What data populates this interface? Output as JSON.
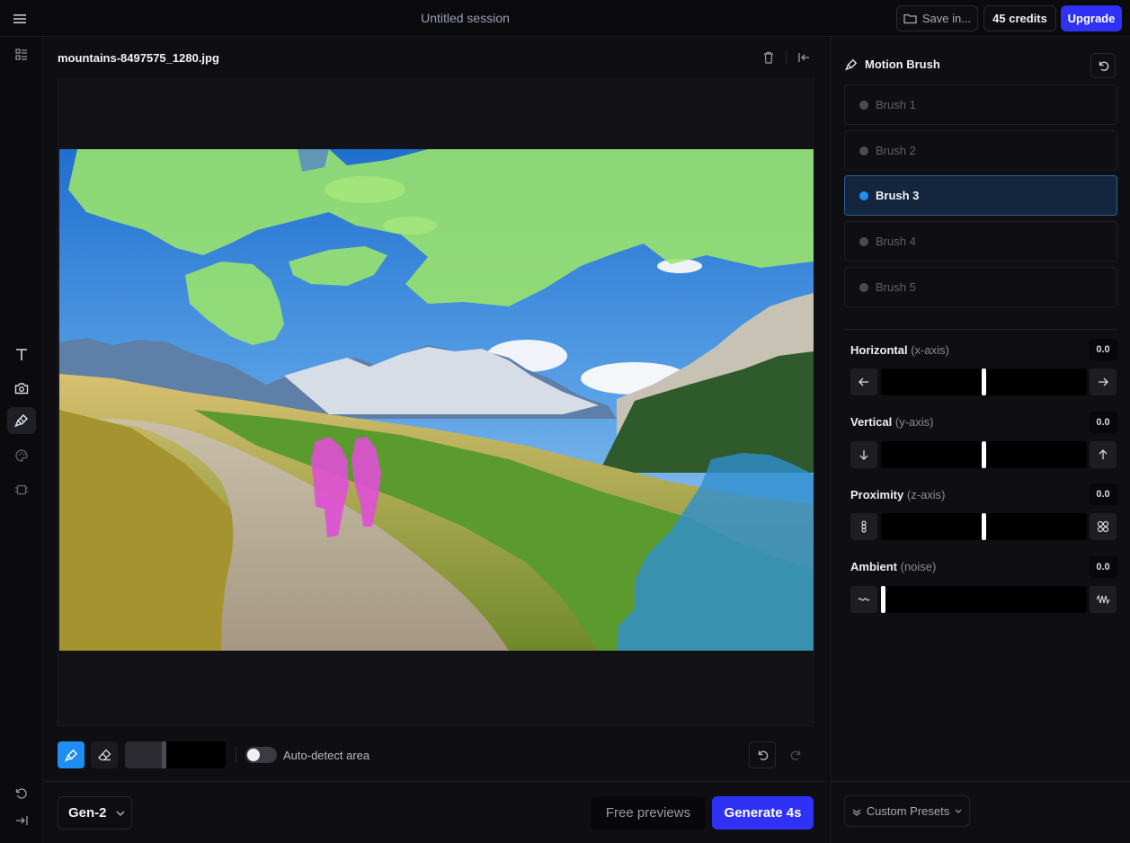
{
  "header": {
    "session_title": "Untitled session",
    "save_label": "Save in...",
    "credits_label": "45 credits",
    "upgrade_label": "Upgrade"
  },
  "left_rail": {
    "items": [
      {
        "icon": "layout-list-icon"
      },
      {
        "icon": "text-icon"
      },
      {
        "icon": "camera-icon"
      },
      {
        "icon": "motion-brush-icon",
        "active": true
      },
      {
        "icon": "palette-icon"
      },
      {
        "icon": "frame-icon"
      },
      {
        "icon": "history-icon"
      },
      {
        "icon": "expand-right-icon"
      }
    ]
  },
  "canvas": {
    "file_name": "mountains-8497575_1280.jpg",
    "auto_detect_label": "Auto-detect area",
    "auto_detect_on": false,
    "brush_size": 0.37
  },
  "footer": {
    "model": "Gen-2",
    "free_previews_label": "Free previews",
    "generate_label": "Generate 4s"
  },
  "motion_panel": {
    "title": "Motion Brush",
    "brushes": [
      {
        "label": "Brush 1",
        "active": false
      },
      {
        "label": "Brush 2",
        "active": false
      },
      {
        "label": "Brush 3",
        "active": true
      },
      {
        "label": "Brush 4",
        "active": false
      },
      {
        "label": "Brush 5",
        "active": false
      }
    ],
    "controls": [
      {
        "label": "Horizontal",
        "sub": "(x-axis)",
        "value": "0.0",
        "level": 0.5,
        "left_icon": "arrow-left-icon",
        "right_icon": "arrow-right-icon"
      },
      {
        "label": "Vertical",
        "sub": "(y-axis)",
        "value": "0.0",
        "level": 0.5,
        "left_icon": "arrow-down-icon",
        "right_icon": "arrow-up-icon"
      },
      {
        "label": "Proximity",
        "sub": "(z-axis)",
        "value": "0.0",
        "level": 0.5,
        "left_icon": "converge-icon",
        "right_icon": "diverge-icon"
      },
      {
        "label": "Ambient",
        "sub": "(noise)",
        "value": "0.0",
        "level": 0.0,
        "left_icon": "low-noise-icon",
        "right_icon": "high-noise-icon"
      }
    ],
    "presets_label": "Custom Presets"
  },
  "colors": {
    "accent_blue": "#2f32f5",
    "brush_blue": "#1e8ef2",
    "brush1_mask": "#9be56a",
    "brush2_mask": "#e04fd6",
    "brush3_mask": "#2f8fd0"
  }
}
